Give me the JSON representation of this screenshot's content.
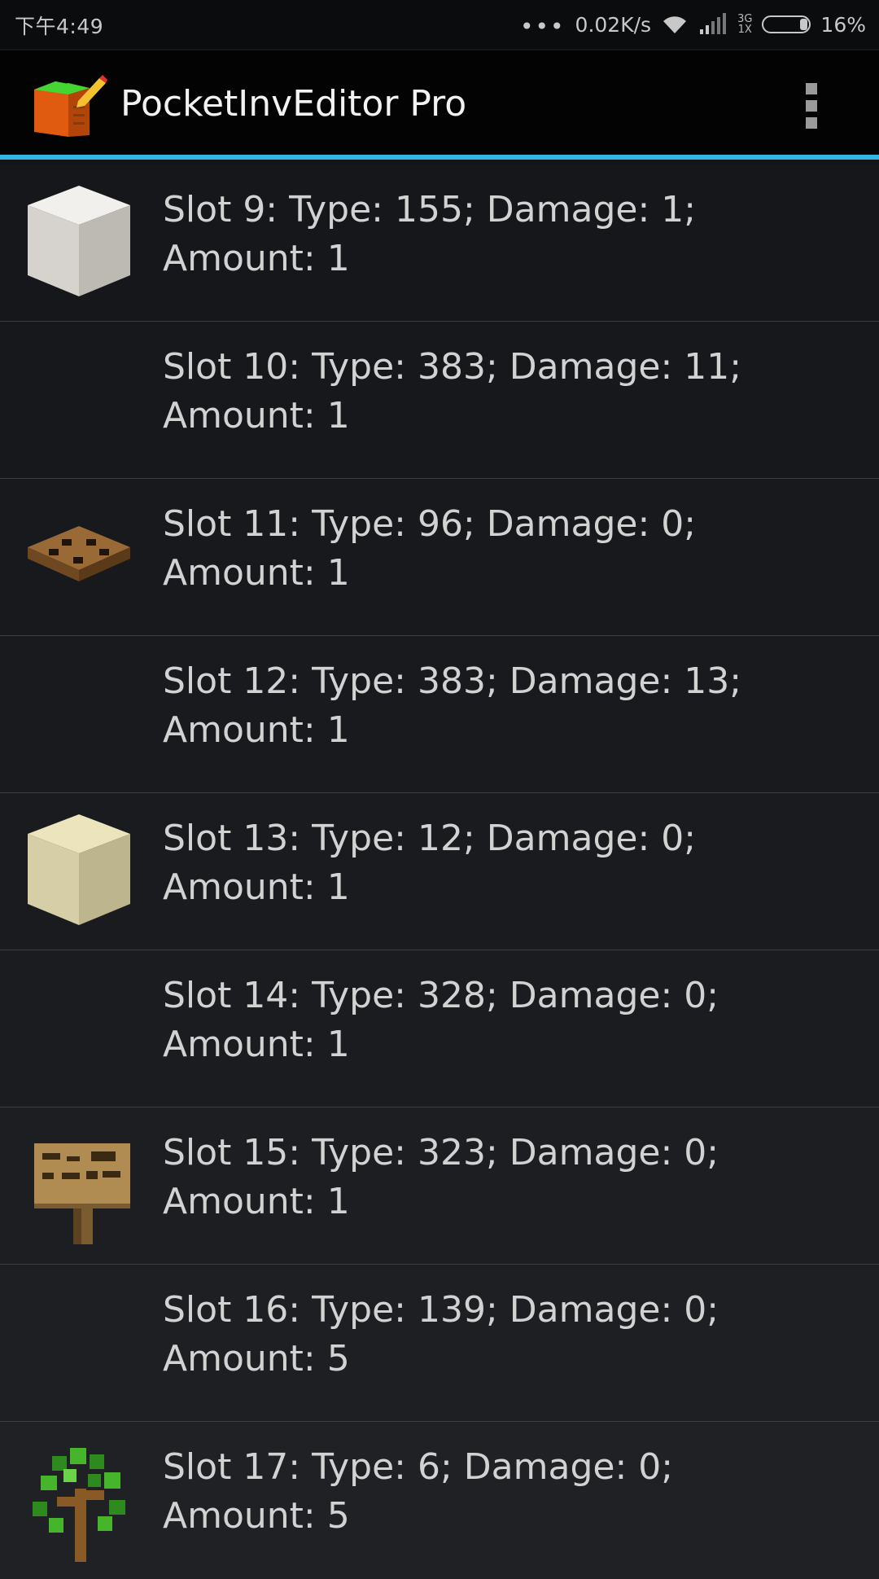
{
  "status_bar": {
    "time": "下午4:49",
    "dots": "•••",
    "net_speed": "0.02K/s",
    "network_type_top": "3G",
    "network_type_bottom": "1X",
    "battery": "16%",
    "battery_level": 0.16
  },
  "action_bar": {
    "title": "PocketInvEditor Pro",
    "accent_color": "#33b5e5"
  },
  "slots": [
    {
      "line1": "Slot 9: Type: 155; Damage: 1;",
      "line2": "Amount: 1",
      "icon": "quartz-block-icon"
    },
    {
      "line1": "Slot 10: Type: 383; Damage: 11;",
      "line2": "Amount: 1",
      "icon": ""
    },
    {
      "line1": "Slot 11: Type: 96; Damage: 0;",
      "line2": "Amount: 1",
      "icon": "trapdoor-icon"
    },
    {
      "line1": "Slot 12: Type: 383; Damage: 13;",
      "line2": "Amount: 1",
      "icon": ""
    },
    {
      "line1": "Slot 13: Type: 12; Damage: 0;",
      "line2": "Amount: 1",
      "icon": "sand-block-icon"
    },
    {
      "line1": "Slot 14: Type: 328; Damage: 0;",
      "line2": "Amount: 1",
      "icon": ""
    },
    {
      "line1": "Slot 15: Type: 323; Damage: 0;",
      "line2": "Amount: 1",
      "icon": "sign-icon"
    },
    {
      "line1": "Slot 16: Type: 139; Damage: 0;",
      "line2": "Amount: 5",
      "icon": ""
    },
    {
      "line1": "Slot 17: Type: 6; Damage: 0;",
      "line2": "Amount: 5",
      "icon": "sapling-icon"
    }
  ]
}
